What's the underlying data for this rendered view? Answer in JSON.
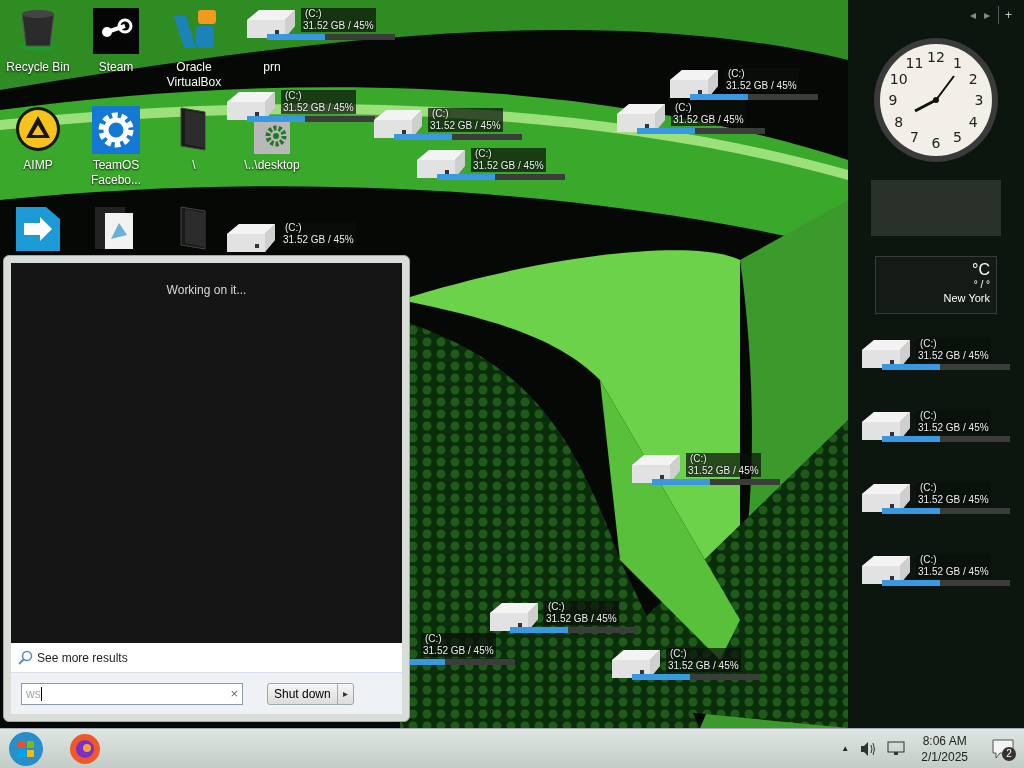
{
  "desktop_icons": [
    {
      "label": "Recycle Bin",
      "kind": "recycle"
    },
    {
      "label": "Steam",
      "kind": "steam"
    },
    {
      "label": "Oracle VirtualBox",
      "kind": "vbox"
    },
    {
      "label": "prn",
      "kind": "hidden"
    },
    {
      "label": "AIMP",
      "kind": "aimp"
    },
    {
      "label": "TeamOS Facebo...",
      "kind": "gear"
    },
    {
      "label": "\\",
      "kind": "folder"
    },
    {
      "label": "\\..\\desktop",
      "kind": "settings-file"
    },
    {
      "kind": "arrow-app"
    },
    {
      "kind": "document"
    },
    {
      "kind": "folder"
    }
  ],
  "drive_gadgets": [
    {
      "drive": "(C:)",
      "usage": "31.52 GB / 45%",
      "level": 0.45,
      "kind": "full"
    },
    {
      "drive": "(C:)",
      "usage": "31.52 GB / 45%",
      "level": 0.45,
      "kind": "full"
    },
    {
      "drive": "(C:)",
      "usage": "31.52 GB / 45%",
      "level": 0.45,
      "kind": "full"
    },
    {
      "drive": "(C:)",
      "usage": "31.52 GB / 45%",
      "level": 0.45,
      "kind": "full"
    },
    {
      "drive": "(C:)",
      "usage": "31.52 GB / 45%",
      "kind": "full"
    },
    {
      "drive": "(C:)",
      "usage": "31.52 GB / 45%",
      "level": 0.45,
      "kind": "full"
    },
    {
      "drive": "(C:)",
      "usage": "31.52 GB / 45%",
      "level": 0.45,
      "kind": "full"
    },
    {
      "drive": "(C:)",
      "usage": "31.52 GB / 45%",
      "level": 0.45,
      "kind": "full"
    },
    {
      "drive": "(C:)",
      "usage": "31.52 GB / 45%",
      "level": 0.45,
      "kind": "full"
    },
    {
      "drive": "(C:)",
      "usage": "31.52 GB / 45%",
      "level": 0.45,
      "kind": "full"
    },
    {
      "drive": "(C:)",
      "usage": "31.52 GB / 45%",
      "level": 0.45,
      "kind": "full"
    },
    {
      "drive": "(C:)",
      "usage": "31.52 GB / 45%",
      "level": 0.45,
      "kind": "full"
    },
    {
      "drive": "(C:)",
      "usage": "31.52 GB / 45%",
      "level": 0.45,
      "kind": "full"
    },
    {
      "drive": "(C:)",
      "usage": "31.52 GB / 45%",
      "level": 0.45,
      "kind": "no-icon"
    },
    {
      "drive": "(C:)",
      "usage": "31.52 GB / 45%",
      "level": 0.45,
      "kind": "full"
    }
  ],
  "start_menu": {
    "status": "Working on it...",
    "see_more": "See more results",
    "search": {
      "value": "ws",
      "clear": "×"
    },
    "shutdown": "Shut down",
    "shutdown_arrow": "▸"
  },
  "sidebar": {
    "controls": [
      "◂",
      "▸",
      "+"
    ],
    "clock": {
      "numerals": [
        "11",
        "12",
        "1",
        "10",
        "2",
        "9",
        "3",
        "8",
        "4",
        "7",
        "6",
        "5"
      ]
    },
    "weather": {
      "unit": "°C",
      "range": "° / °",
      "city": "New York"
    }
  },
  "taskbar": {
    "tray_caret": "▲",
    "time": "8:06 AM",
    "date": "2/1/2025",
    "notifications": "2"
  }
}
